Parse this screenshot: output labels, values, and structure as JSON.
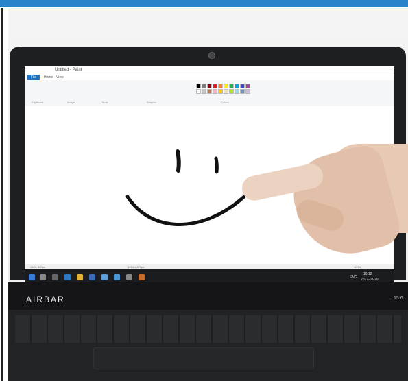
{
  "paint": {
    "title": "Untitled - Paint",
    "tabs": [
      "File",
      "Home",
      "View"
    ],
    "groups": [
      "Clipboard",
      "Image",
      "Tools",
      "Shapes",
      "Colors"
    ],
    "status_left": "1524, 803px",
    "status_mid": "1914 × 870px",
    "zoom": "100%"
  },
  "taskbar": {
    "lang": "ENG",
    "time": "16:12",
    "date": "2017-03-29"
  },
  "laptop": {
    "brand": "AIRBAR",
    "size": "15.6"
  },
  "colors": {
    "accent_bar": "#2a84c9",
    "swatches": [
      "#000000",
      "#7f7f7f",
      "#880015",
      "#ed1c24",
      "#ff7f27",
      "#fff200",
      "#22b14c",
      "#00a2e8",
      "#3f48cc",
      "#a349a4",
      "#ffffff",
      "#c3c3c3",
      "#b97a57",
      "#ffaec9",
      "#ffc90e",
      "#efe4b0",
      "#b5e61d",
      "#99d9ea",
      "#7092be",
      "#c8bfe7"
    ]
  }
}
